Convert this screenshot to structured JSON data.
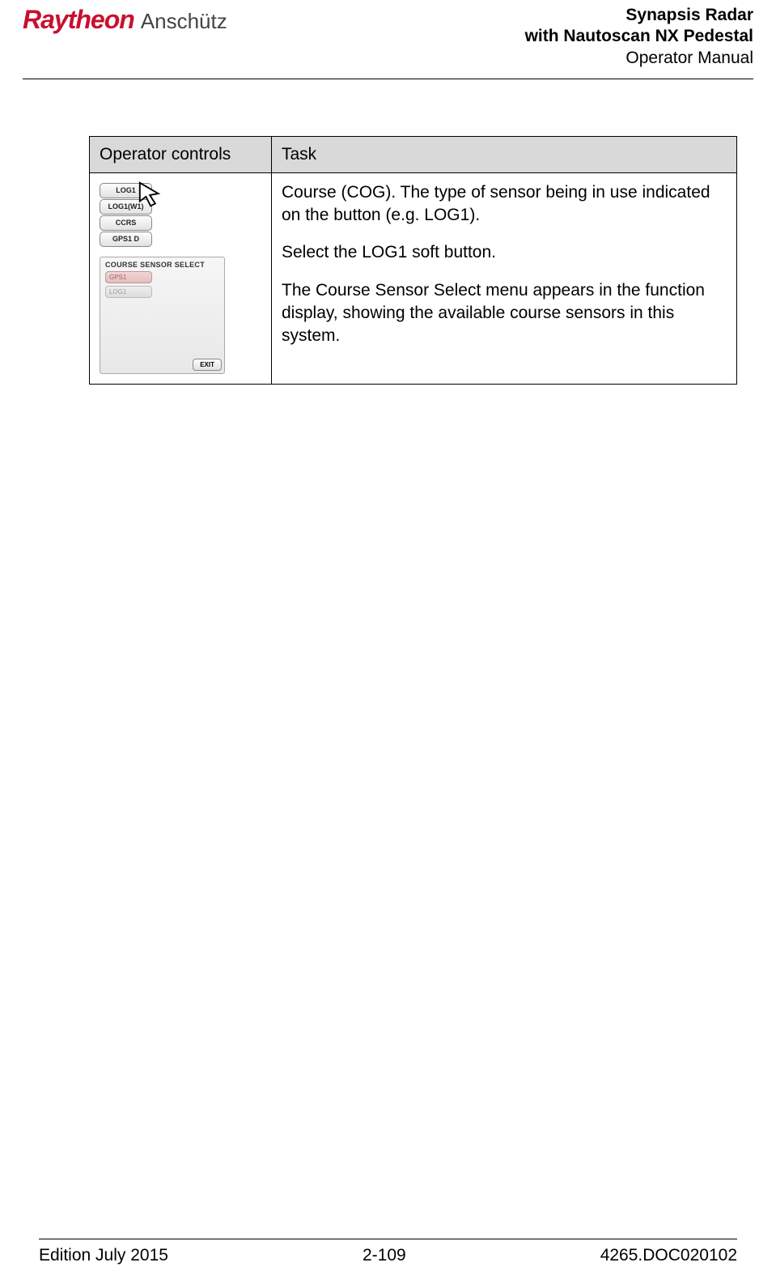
{
  "header": {
    "logo_brand": "Raytheon",
    "logo_sub": "Anschütz",
    "title_line1": "Synapsis Radar",
    "title_line2": "with Nautoscan NX Pedestal",
    "title_line3": "Operator Manual"
  },
  "table": {
    "col1_header": "Operator controls",
    "col2_header": "Task",
    "ui": {
      "buttons": [
        "LOG1",
        "LOG1(W1)",
        "CCRS",
        "GPS1 D"
      ],
      "panel_title": "COURSE SENSOR SELECT",
      "panel_options": [
        "GPS1",
        "LOG1"
      ],
      "panel_exit": "EXIT"
    },
    "task": {
      "p1": "Course (COG). The type of sensor being in use indicated on the button (e.g. LOG1).",
      "p2": "Select the LOG1 soft button.",
      "p3": "The Course Sensor Select menu appears in the function display, showing the available course sensors in this system."
    }
  },
  "footer": {
    "left": "Edition July 2015",
    "center": "2-109",
    "right": "4265.DOC020102"
  }
}
